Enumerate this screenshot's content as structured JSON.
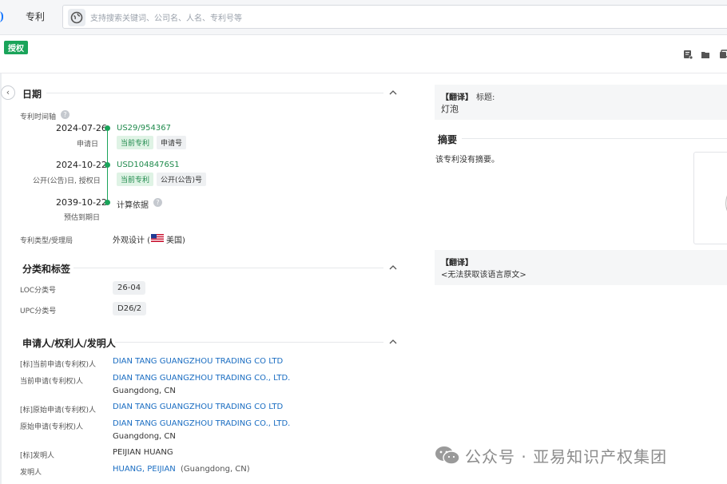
{
  "header": {
    "tab_label": "专利",
    "search_placeholder": "支持搜索关键词、公司名、人名、专利号等"
  },
  "toolbar": {
    "status_badge": "授权"
  },
  "date_section": {
    "title": "日期",
    "timeline_label": "专利时间轴",
    "events": [
      {
        "date": "2024-07-26",
        "sublabel": "申请日",
        "number": "US29/954367",
        "tags": [
          "当前专利",
          "申请号"
        ]
      },
      {
        "date": "2024-10-22",
        "sublabel": "公开(公告)日, 授权日",
        "number": "USD1048476S1",
        "tags": [
          "当前专利",
          "公开(公告)号"
        ]
      },
      {
        "date": "2039-10-22",
        "sublabel": "预估到期日",
        "number": "计算依据"
      }
    ],
    "type_label": "专利类型/受理局",
    "type_value": "外观设计 (",
    "country": "美国)"
  },
  "classification": {
    "title": "分类和标签",
    "loc_label": "LOC分类号",
    "loc_value": "26-04",
    "upc_label": "UPC分类号",
    "upc_value": "D26/2"
  },
  "parties": {
    "title": "申请人/权利人/发明人",
    "rows": [
      {
        "label": "[标]当前申请(专利权)人",
        "value": "DIAN TANG GUANGZHOU TRADING CO LTD"
      },
      {
        "label": "当前申请(专利权)人",
        "value": "DIAN TANG GUANGZHOU TRADING CO., LTD.",
        "sub": "Guangdong, CN"
      },
      {
        "label": "[标]原始申请(专利权)人",
        "value": "DIAN TANG GUANGZHOU TRADING CO LTD"
      },
      {
        "label": "原始申请(专利权)人",
        "value": "DIAN TANG GUANGZHOU TRADING CO., LTD.",
        "sub": "Guangdong, CN"
      },
      {
        "label": "[标]发明人",
        "value": "PEIJIAN HUANG"
      },
      {
        "label": "发明人",
        "value": "HUANG, PEIJIAN",
        "suffix": "(Guangdong, CN)"
      }
    ]
  },
  "right": {
    "translate_tag": "【翻译】",
    "title_label": "标题:",
    "title_value": "灯泡",
    "abstract_title": "摘要",
    "abstract_text": "该专利没有摘要。",
    "translate2_tag": "【翻译】",
    "translate2_text": "<无法获取该语言原文>"
  },
  "watermark": "公众号 · 亚易知识产权集团",
  "colors": {
    "accent_green": "#1aa45a",
    "link_blue": "#1a6dc2"
  }
}
